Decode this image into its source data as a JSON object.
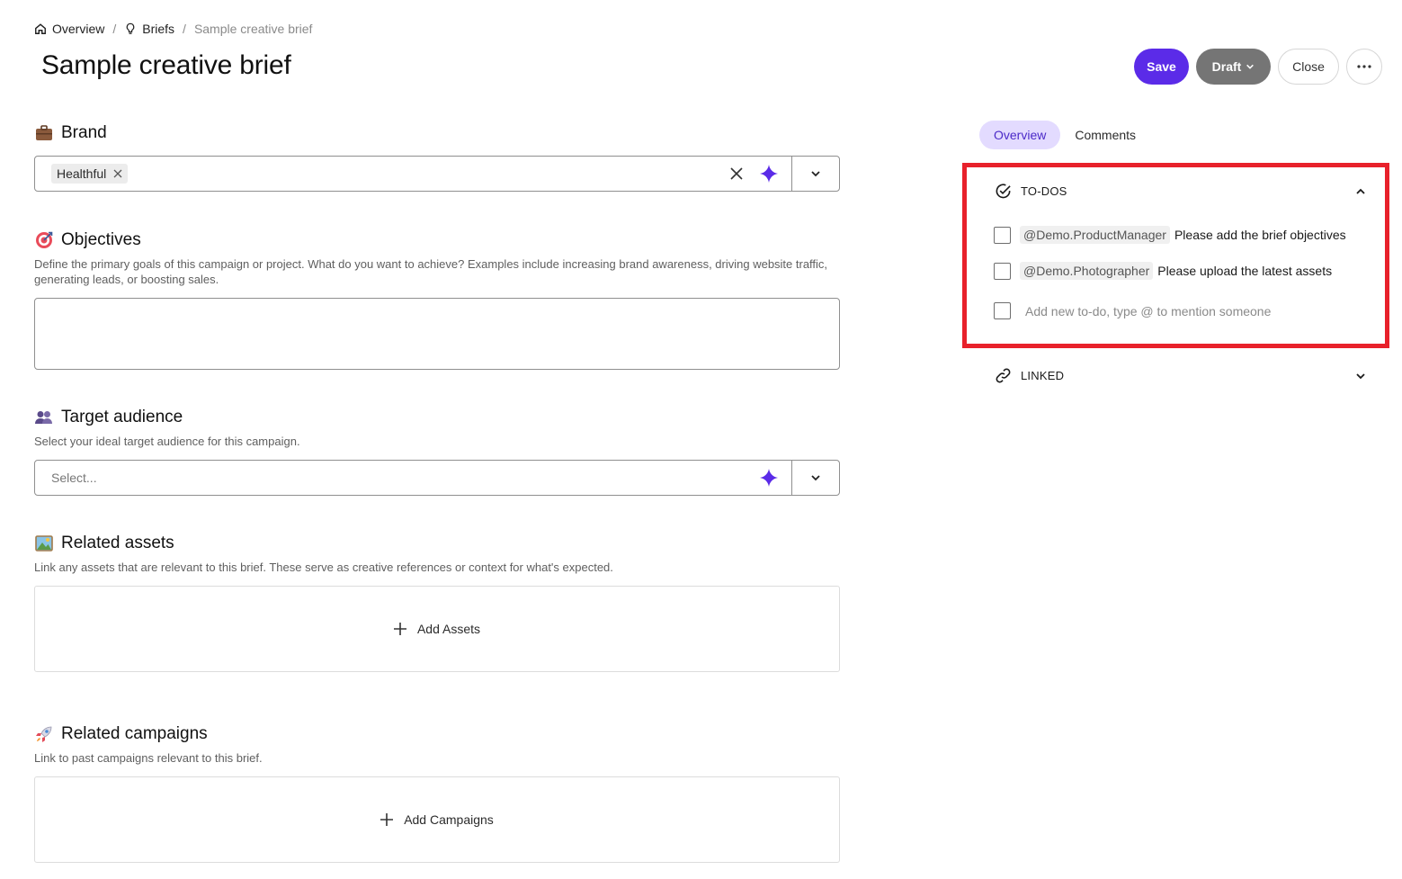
{
  "breadcrumb": {
    "items": [
      {
        "label": "Overview",
        "icon": "home-icon"
      },
      {
        "label": "Briefs",
        "icon": "lightbulb-icon"
      },
      {
        "label": "Sample creative brief"
      }
    ],
    "separator": "/"
  },
  "page": {
    "title": "Sample creative brief"
  },
  "actions": {
    "save": "Save",
    "draft": "Draft",
    "close": "Close",
    "more": "more-horizontal-icon"
  },
  "colors": {
    "accent": "#5b2be8",
    "draft": "#757575",
    "tab_active_bg": "#e3dbff",
    "highlight_border": "#e8212b"
  },
  "sections": {
    "brand": {
      "icon": "briefcase-icon",
      "title": "Brand",
      "selected_tag": "Healthful"
    },
    "objectives": {
      "icon": "target-icon",
      "title": "Objectives",
      "description": "Define the primary goals of this campaign or project. What do you want to achieve? Examples include increasing brand awareness, driving website traffic, generating leads, or boosting sales.",
      "value": ""
    },
    "target_audience": {
      "icon": "people-icon",
      "title": "Target audience",
      "description": "Select your ideal target audience for this campaign.",
      "placeholder": "Select..."
    },
    "related_assets": {
      "icon": "picture-icon",
      "title": "Related assets",
      "description": "Link any assets that are relevant to this brief. These serve as creative references or context for what's expected.",
      "add_label": "Add Assets"
    },
    "related_campaigns": {
      "icon": "rocket-icon",
      "title": "Related campaigns",
      "description": "Link to past campaigns relevant to this brief.",
      "add_label": "Add Campaigns"
    }
  },
  "side_panel": {
    "tabs": [
      {
        "label": "Overview",
        "active": true
      },
      {
        "label": "Comments",
        "active": false
      }
    ],
    "todos": {
      "title": "TO-DOS",
      "items": [
        {
          "mention": "@Demo.ProductManager",
          "text": "Please add the brief objectives",
          "checked": false
        },
        {
          "mention": "@Demo.Photographer",
          "text": "Please upload the latest assets",
          "checked": false
        }
      ],
      "new_placeholder": "Add new to-do, type @ to mention someone"
    },
    "linked": {
      "title": "LINKED"
    }
  }
}
